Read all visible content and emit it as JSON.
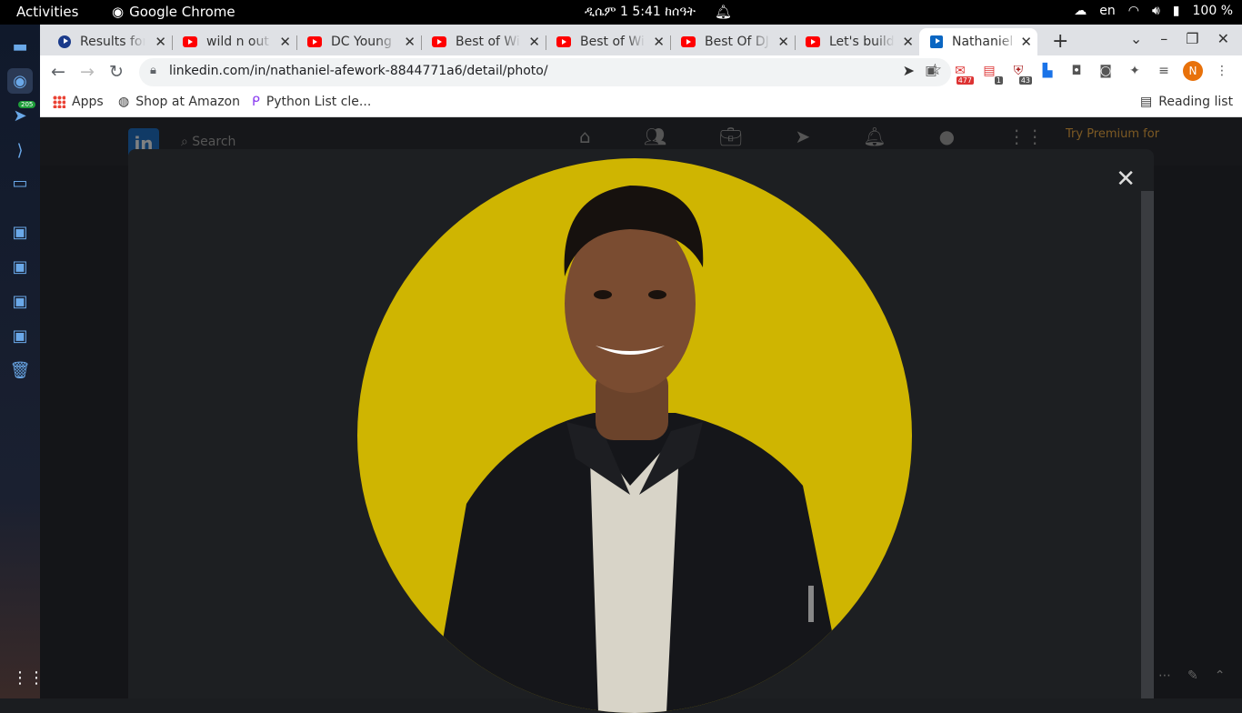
{
  "system": {
    "activities": "Activities",
    "app_name": "Google Chrome",
    "clock": "ዲሴም 1  5:41 ከሰዓት",
    "keyboard": "en",
    "battery": "100 %",
    "dock_badge": "205"
  },
  "browser": {
    "tabs": [
      {
        "title": "Results for",
        "icon": "results-icon"
      },
      {
        "title": "wild n out c",
        "icon": "youtube-icon"
      },
      {
        "title": "DC Young F",
        "icon": "youtube-icon"
      },
      {
        "title": "Best of Wil",
        "icon": "youtube-icon"
      },
      {
        "title": "Best of Wil",
        "icon": "youtube-icon"
      },
      {
        "title": "Best Of DJ",
        "icon": "youtube-icon"
      },
      {
        "title": "Let's build",
        "icon": "youtube-icon"
      },
      {
        "title": "Nathaniel A",
        "icon": "linkedin-icon",
        "active": true
      }
    ],
    "url": "linkedin.com/in/nathaniel-afework-8844771a6/detail/photo/",
    "extensions": {
      "gmail_badge": "477",
      "ext2_badge": "1",
      "ext3_badge": "43",
      "profile_initial": "N"
    },
    "bookmarks": {
      "apps": "Apps",
      "amazon": "Shop at Amazon",
      "python": "Python List cle...",
      "reading_list": "Reading list"
    }
  },
  "linkedin": {
    "logo": "in",
    "search_placeholder": "Search",
    "premium": "Try Premium for",
    "photo_owner": "Nathaniel Afework"
  },
  "colors": {
    "photo_background": "#cfb501",
    "modal": "#1d1f22",
    "linkedin_blue": "#0a66c2"
  }
}
